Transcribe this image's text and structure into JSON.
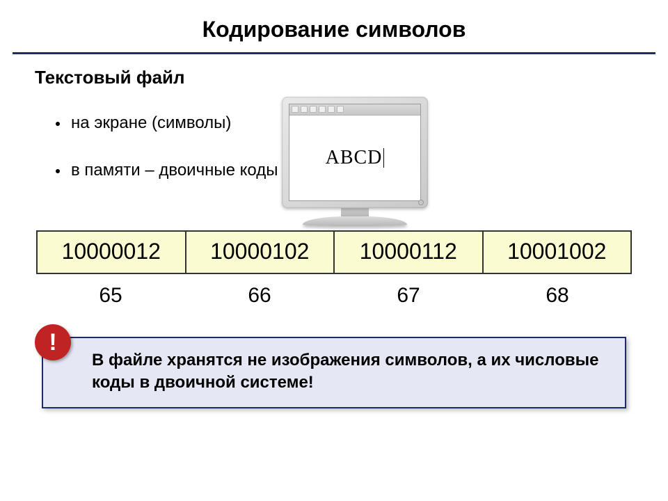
{
  "title": "Кодирование символов",
  "subtitle": "Текстовый файл",
  "bullets": [
    "на экране (символы)",
    "в памяти – двоичные коды"
  ],
  "screen_text": "ABCD",
  "binary_row": [
    "10000012",
    "10000102",
    "10000112",
    "10001002"
  ],
  "decimal_row": [
    "65",
    "66",
    "67",
    "68"
  ],
  "note_badge": "!",
  "note_text": "В файле хранятся не изображения символов, а их числовые коды в двоичной системе!"
}
